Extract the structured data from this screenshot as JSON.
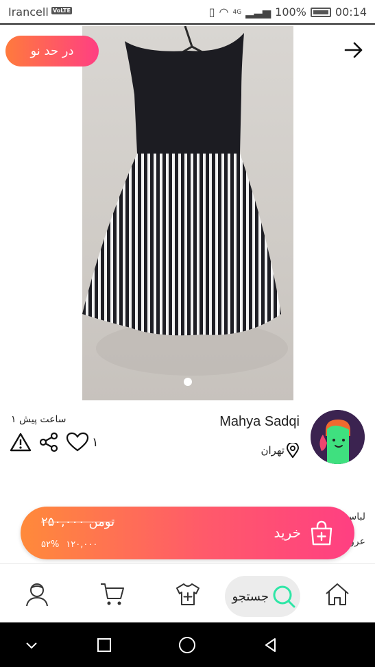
{
  "status_bar": {
    "carrier": "Irancell",
    "volte": "VoLTE",
    "network": "4G",
    "battery": "100%",
    "time": "00:14"
  },
  "header": {
    "offer_label": "در حد نو"
  },
  "listing": {
    "time_ago": "۱ ساعت پیش",
    "like_count": "۱",
    "seller_name": "Mahya Sadqi",
    "location": "تهران",
    "side_text_1": "لباس",
    "side_text_2": "عرو"
  },
  "buy_bar": {
    "old_price": "۲۵۰,۰۰۰ تومن",
    "new_price": "۱۲۰,۰۰۰",
    "discount": "۵۲%",
    "buy_label": "خرید"
  },
  "bottom_nav": {
    "search_label": "جستجو"
  },
  "colors": {
    "accent_start": "#ff8a3a",
    "accent_end": "#ff3f82",
    "search_icon": "#2ee6a6"
  },
  "icons": [
    "back-arrow-icon",
    "warning-icon",
    "share-icon",
    "heart-icon",
    "location-pin-icon",
    "shopping-bag-icon",
    "home-icon",
    "search-icon",
    "add-clothing-icon",
    "cart-icon",
    "profile-icon"
  ]
}
